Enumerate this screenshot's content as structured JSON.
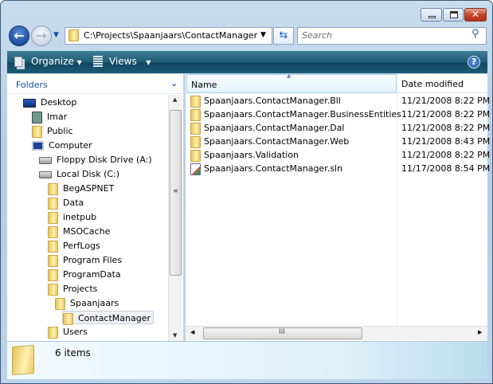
{
  "window": {
    "controls": [
      "minimize",
      "maximize",
      "close"
    ]
  },
  "nav": {
    "back": "back-icon",
    "forward": "forward-icon"
  },
  "address": {
    "path": "C:\\Projects\\Spaanjaars\\ContactManager"
  },
  "search": {
    "placeholder": "Search"
  },
  "toolbar": {
    "organize": "Organize",
    "views": "Views"
  },
  "folders_pane": {
    "title": "Folders",
    "items": [
      {
        "label": "Desktop",
        "icon": "desktop-icon",
        "level": 0
      },
      {
        "label": "Imar",
        "icon": "user-folder-icon",
        "level": 1
      },
      {
        "label": "Public",
        "icon": "folder-icon",
        "level": 1
      },
      {
        "label": "Computer",
        "icon": "computer-icon",
        "level": 1
      },
      {
        "label": "Floppy Disk Drive (A:)",
        "icon": "floppy-drive-icon",
        "level": 2
      },
      {
        "label": "Local Disk (C:)",
        "icon": "hard-disk-icon",
        "level": 2
      },
      {
        "label": "BegASPNET",
        "icon": "folder-icon",
        "level": 3
      },
      {
        "label": "Data",
        "icon": "folder-icon",
        "level": 3
      },
      {
        "label": "inetpub",
        "icon": "folder-icon",
        "level": 3
      },
      {
        "label": "MSOCache",
        "icon": "folder-icon",
        "level": 3
      },
      {
        "label": "PerfLogs",
        "icon": "folder-icon",
        "level": 3
      },
      {
        "label": "Program Files",
        "icon": "folder-icon",
        "level": 3
      },
      {
        "label": "ProgramData",
        "icon": "folder-icon",
        "level": 3
      },
      {
        "label": "Projects",
        "icon": "folder-icon",
        "level": 3
      },
      {
        "label": "Spaanjaars",
        "icon": "folder-icon",
        "level": 4
      },
      {
        "label": "ContactManager",
        "icon": "folder-icon",
        "level": 5,
        "selected": true
      },
      {
        "label": "Users",
        "icon": "folder-icon",
        "level": 3
      }
    ]
  },
  "file_list": {
    "columns": [
      "Name",
      "Date modified"
    ],
    "rows": [
      {
        "name": "Spaanjaars.ContactManager.Bll",
        "date": "11/21/2008 8:22 PM",
        "icon": "folder-icon"
      },
      {
        "name": "Spaanjaars.ContactManager.BusinessEntities",
        "date": "11/21/2008 8:22 PM",
        "icon": "folder-icon"
      },
      {
        "name": "Spaanjaars.ContactManager.Dal",
        "date": "11/21/2008 8:22 PM",
        "icon": "folder-icon"
      },
      {
        "name": "Spaanjaars.ContactManager.Web",
        "date": "11/21/2008 8:43 PM",
        "icon": "folder-icon"
      },
      {
        "name": "Spaanjaars.Validation",
        "date": "11/21/2008 8:22 PM",
        "icon": "folder-icon"
      },
      {
        "name": "Spaanjaars.ContactManager.sln",
        "date": "11/17/2008 8:54 PM",
        "icon": "solution-file-icon"
      }
    ]
  },
  "status": {
    "text": "6 items"
  },
  "colors": {
    "toolbar": "#1e5a72",
    "frame": "#bcd3ea",
    "selection": "#e8eef5"
  }
}
